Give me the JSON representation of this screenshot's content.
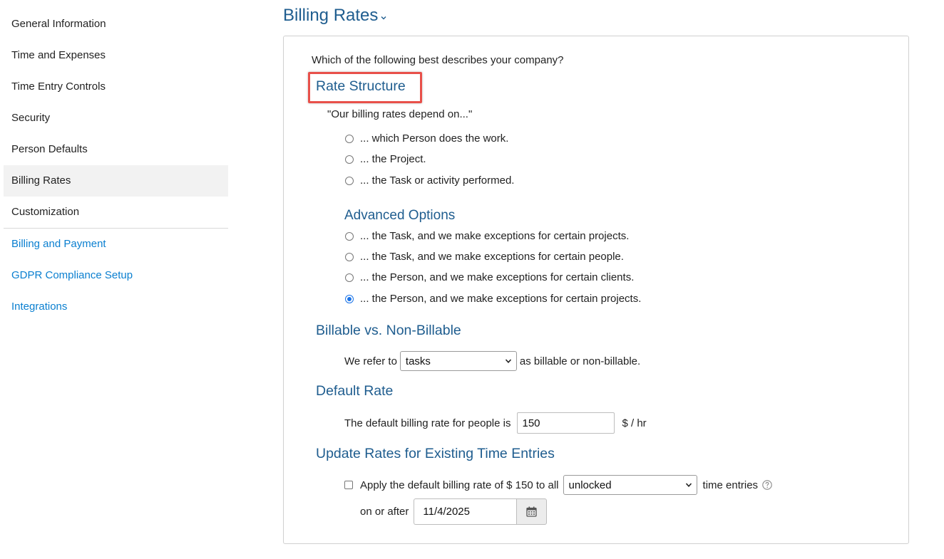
{
  "sidebar": {
    "items": [
      {
        "label": "General Information"
      },
      {
        "label": "Time and Expenses"
      },
      {
        "label": "Time Entry Controls"
      },
      {
        "label": "Security"
      },
      {
        "label": "Person Defaults"
      },
      {
        "label": "Billing Rates",
        "active": true
      },
      {
        "label": "Customization"
      }
    ],
    "links": [
      {
        "label": "Billing and Payment"
      },
      {
        "label": "GDPR Compliance Setup"
      },
      {
        "label": "Integrations"
      }
    ]
  },
  "header": {
    "title": "Billing Rates"
  },
  "panel": {
    "question": "Which of the following best describes your company?",
    "rate_structure": {
      "title": "Rate Structure",
      "quote": "\"Our billing rates depend on...\"",
      "options": [
        {
          "label": "... which Person does the work.",
          "checked": false
        },
        {
          "label": "... the Project.",
          "checked": false
        },
        {
          "label": "... the Task or activity performed.",
          "checked": false
        }
      ]
    },
    "advanced": {
      "title": "Advanced Options",
      "options": [
        {
          "label": "... the Task, and we make exceptions for certain projects.",
          "checked": false
        },
        {
          "label": "... the Task, and we make exceptions for certain people.",
          "checked": false
        },
        {
          "label": "... the Person, and we make exceptions for certain clients.",
          "checked": false
        },
        {
          "label": "... the Person, and we make exceptions for certain projects.",
          "checked": true
        }
      ]
    },
    "billable": {
      "title": "Billable vs. Non-Billable",
      "prefix": "We refer to",
      "select_value": "tasks",
      "suffix": "as billable or non-billable."
    },
    "default_rate": {
      "title": "Default Rate",
      "label": "The default billing rate for people is",
      "value": "150",
      "unit": "$ / hr"
    },
    "update_rates": {
      "title": "Update Rates for Existing Time Entries",
      "apply_label": "Apply the default billing rate of $ 150 to all",
      "apply_checked": false,
      "select_value": "unlocked",
      "suffix": "time entries",
      "date_label": "on or after",
      "date_value": "11/4/2025"
    }
  },
  "colors": {
    "heading": "#1f5d8f",
    "link": "#0a7fd0",
    "highlight_box": "#e8504a",
    "radio_checked": "#1a73e8"
  }
}
